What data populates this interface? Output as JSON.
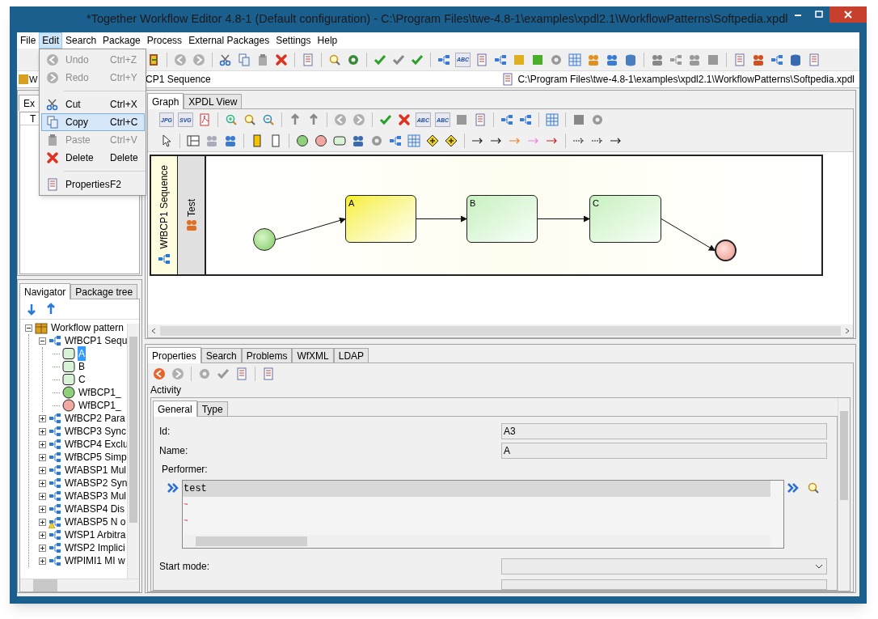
{
  "window": {
    "title": "*Together Workflow Editor 4.8-1 (Default configuration) - C:\\Program Files\\twe-4.8-1\\examples\\xpdl2.1\\WorkflowPatterns\\Softpedia.xpdl"
  },
  "menu_bar": [
    {
      "label": "File",
      "selected": false
    },
    {
      "label": "Edit",
      "selected": true
    },
    {
      "label": "Search",
      "selected": false
    },
    {
      "label": "Package",
      "selected": false
    },
    {
      "label": "Process",
      "selected": false
    },
    {
      "label": "External Packages",
      "selected": false
    },
    {
      "label": "Settings",
      "selected": false
    },
    {
      "label": "Help",
      "selected": false
    }
  ],
  "edit_menu": [
    {
      "kind": "item",
      "label": "Undo",
      "shortcut": "Ctrl+Z",
      "disabled": true,
      "selected": false
    },
    {
      "kind": "item",
      "label": "Redo",
      "shortcut": "Ctrl+Y",
      "disabled": true,
      "selected": false
    },
    {
      "kind": "separator"
    },
    {
      "kind": "item",
      "label": "Cut",
      "shortcut": "Ctrl+X",
      "disabled": false,
      "selected": false
    },
    {
      "kind": "item",
      "label": "Copy",
      "shortcut": "Ctrl+C",
      "disabled": false,
      "selected": true
    },
    {
      "kind": "item",
      "label": "Paste",
      "shortcut": "Ctrl+V",
      "disabled": true,
      "selected": false
    },
    {
      "kind": "item",
      "label": "Delete",
      "shortcut": "Delete",
      "disabled": false,
      "selected": false
    },
    {
      "kind": "separator"
    },
    {
      "kind": "item",
      "label": "Properties",
      "shortcut": "F2",
      "disabled": false,
      "selected": false
    }
  ],
  "main_toolbar": {
    "icon_text": "ABC"
  },
  "package_selector": {
    "value": "W"
  },
  "process_field": {
    "value": "CP1 Sequence"
  },
  "file_path": "C:\\Program Files\\twe-4.8-1\\examples\\xpdl2.1\\WorkflowPatterns\\Softpedia.xpdl",
  "left_top_panel": {
    "tab": "Ex",
    "column": "T"
  },
  "navigator": {
    "tabs": [
      {
        "label": "Navigator",
        "selected": true
      },
      {
        "label": "Package tree",
        "selected": false
      }
    ],
    "tree": [
      {
        "kind": "package",
        "label": "Workflow pattern",
        "expanded": true,
        "selected": false,
        "children": [
          {
            "kind": "process",
            "label": "WfBCP1 Sequ",
            "expanded": true,
            "warning": false,
            "selected": false,
            "children": [
              {
                "kind": "activity",
                "label": "A",
                "selected": true
              },
              {
                "kind": "activity",
                "label": "B",
                "selected": false
              },
              {
                "kind": "activity",
                "label": "C",
                "selected": false
              },
              {
                "kind": "start",
                "label": "WfBCP1_",
                "selected": false
              },
              {
                "kind": "end",
                "label": "WfBCP1_",
                "selected": false
              }
            ]
          },
          {
            "kind": "process",
            "label": "WfBCP2 Para",
            "expanded": false,
            "warning": false,
            "selected": false
          },
          {
            "kind": "process",
            "label": "WfBCP3 Sync",
            "expanded": false,
            "warning": false,
            "selected": false
          },
          {
            "kind": "process",
            "label": "WfBCP4 Exclu",
            "expanded": false,
            "warning": false,
            "selected": false
          },
          {
            "kind": "process",
            "label": "WfBCP5 Simp",
            "expanded": false,
            "warning": false,
            "selected": false
          },
          {
            "kind": "process",
            "label": "WfABSP1 Mul",
            "expanded": false,
            "warning": false,
            "selected": false
          },
          {
            "kind": "process",
            "label": "WfABSP2 Syn",
            "expanded": false,
            "warning": false,
            "selected": false
          },
          {
            "kind": "process",
            "label": "WfABSP3 Mul",
            "expanded": false,
            "warning": false,
            "selected": false
          },
          {
            "kind": "process",
            "label": "WfABSP4 Dis",
            "expanded": false,
            "warning": false,
            "selected": false
          },
          {
            "kind": "process",
            "label": "WfABSP5 N o",
            "expanded": false,
            "warning": true,
            "selected": false
          },
          {
            "kind": "process",
            "label": "WfSP1 Arbitra",
            "expanded": false,
            "warning": false,
            "selected": false
          },
          {
            "kind": "process",
            "label": "WfSP2 Implici",
            "expanded": false,
            "warning": false,
            "selected": false
          },
          {
            "kind": "process",
            "label": "WfPIMI1 MI w",
            "expanded": false,
            "warning": false,
            "selected": false
          }
        ]
      }
    ]
  },
  "graph": {
    "tabs": [
      {
        "label": "Graph",
        "selected": true
      },
      {
        "label": "XPDL View",
        "selected": false
      }
    ],
    "toolbar_icon_texts": [
      "JPG",
      "SVG",
      "ABC",
      "ABC"
    ],
    "pool": "WfBCP1 Sequence",
    "lane": "Test",
    "nodes": [
      {
        "kind": "start"
      },
      {
        "kind": "activity",
        "label": "A",
        "selected": true
      },
      {
        "kind": "activity",
        "label": "B",
        "selected": false
      },
      {
        "kind": "activity",
        "label": "C",
        "selected": false
      },
      {
        "kind": "end"
      }
    ]
  },
  "properties": {
    "tabs": [
      {
        "label": "Properties",
        "selected": true
      },
      {
        "label": "Search",
        "selected": false
      },
      {
        "label": "Problems",
        "selected": false
      },
      {
        "label": "WfXML",
        "selected": false
      },
      {
        "label": "LDAP",
        "selected": false
      }
    ],
    "heading": "Activity",
    "subtabs": [
      {
        "label": "General",
        "selected": true
      },
      {
        "label": "Type",
        "selected": false
      }
    ],
    "id": {
      "label": "Id:",
      "value": "A3"
    },
    "name": {
      "label": "Name:",
      "value": "A"
    },
    "performer": {
      "label": "Performer:",
      "lines": [
        {
          "text": "test",
          "selected": true
        },
        {
          "text": "~",
          "selected": false
        },
        {
          "text": "~",
          "selected": false
        }
      ]
    },
    "start_mode": {
      "label": "Start mode:"
    }
  }
}
